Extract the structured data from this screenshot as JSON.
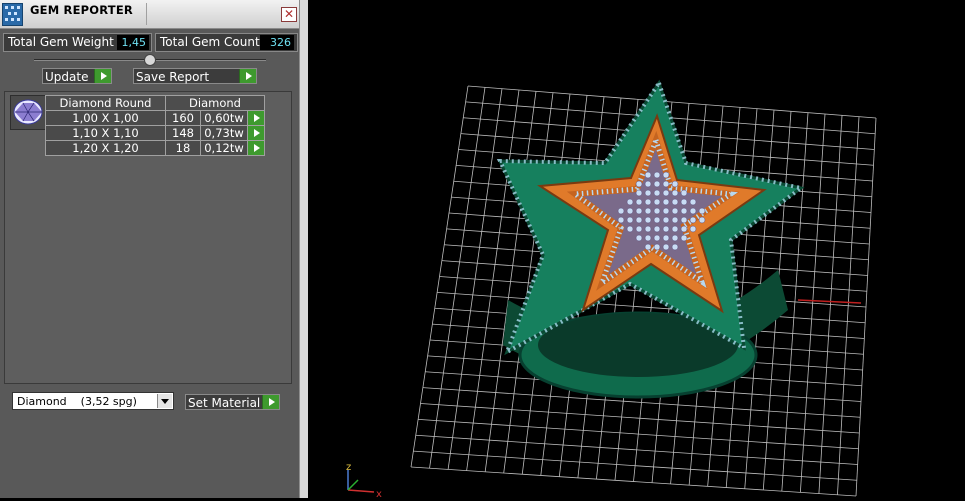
{
  "window": {
    "title": "GEM REPORTER",
    "close_glyph": "✕"
  },
  "stats": {
    "weight_label": "Total Gem Weight",
    "weight_value": "1,45",
    "count_label": "Total Gem Count",
    "count_value": "326"
  },
  "buttons": {
    "update": "Update",
    "save_report": "Save Report",
    "set_material": "Set Material"
  },
  "gem_table": {
    "headers": [
      "Diamond Round",
      "Diamond"
    ],
    "rows": [
      {
        "size": "1,00 X 1,00",
        "count": "160",
        "weight": "0,60tw"
      },
      {
        "size": "1,10 X 1,10",
        "count": "148",
        "weight": "0,73tw"
      },
      {
        "size": "1,20 X 1,20",
        "count": "18",
        "weight": "0,12tw"
      }
    ]
  },
  "material": {
    "selected": "Diamond    (3,52 spg)"
  },
  "viewport": {
    "axis_x": "x",
    "axis_z": "z"
  },
  "colors": {
    "accent_green": "#3e9a2e",
    "value_cyan": "#6ee0f2",
    "ring_green": "#16805e",
    "inlay_orange": "#e07a2a"
  },
  "icons": [
    "gem-reporter-app-icon",
    "close-icon",
    "play-icon",
    "gem-thumbnail-icon",
    "chevron-down-icon",
    "axis-gizmo-icon"
  ]
}
